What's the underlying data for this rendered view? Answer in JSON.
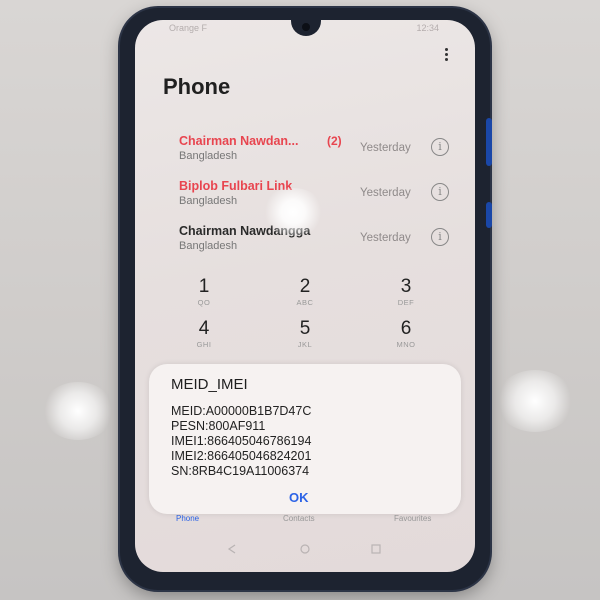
{
  "status_bar": {
    "left": "Orange F",
    "right": "12:34"
  },
  "header": {
    "title": "Phone"
  },
  "calls": [
    {
      "name": "Chairman Nawdan...",
      "count": "(2)",
      "location": "Bangladesh",
      "time": "Yesterday",
      "missed": true
    },
    {
      "name": "Biplob Fulbari Link",
      "location": "Bangladesh",
      "time": "Yesterday",
      "missed": true
    },
    {
      "name": "Chairman Nawdangga",
      "location": "Bangladesh",
      "time": "Yesterday",
      "missed": false
    }
  ],
  "keypad": [
    {
      "digit": "1",
      "letters": "QO"
    },
    {
      "digit": "2",
      "letters": "ABC"
    },
    {
      "digit": "3",
      "letters": "DEF"
    },
    {
      "digit": "4",
      "letters": "GHI"
    },
    {
      "digit": "5",
      "letters": "JKL"
    },
    {
      "digit": "6",
      "letters": "MNO"
    }
  ],
  "dialog": {
    "title": "MEID_IMEI",
    "lines": [
      "MEID:A00000B1B7D47C",
      "PESN:800AF911",
      "IMEI1:866405046786194",
      "IMEI2:866405046824201",
      "SN:8RB4C19A11006374"
    ],
    "ok_label": "OK"
  },
  "tabs": {
    "phone": "Phone",
    "contacts": "Contacts",
    "favourites": "Favourites"
  },
  "icons": {
    "info": "info-icon",
    "menu": "more-vert-icon"
  },
  "colors": {
    "missed_call": "#e8454f",
    "accent": "#2c63e6"
  }
}
